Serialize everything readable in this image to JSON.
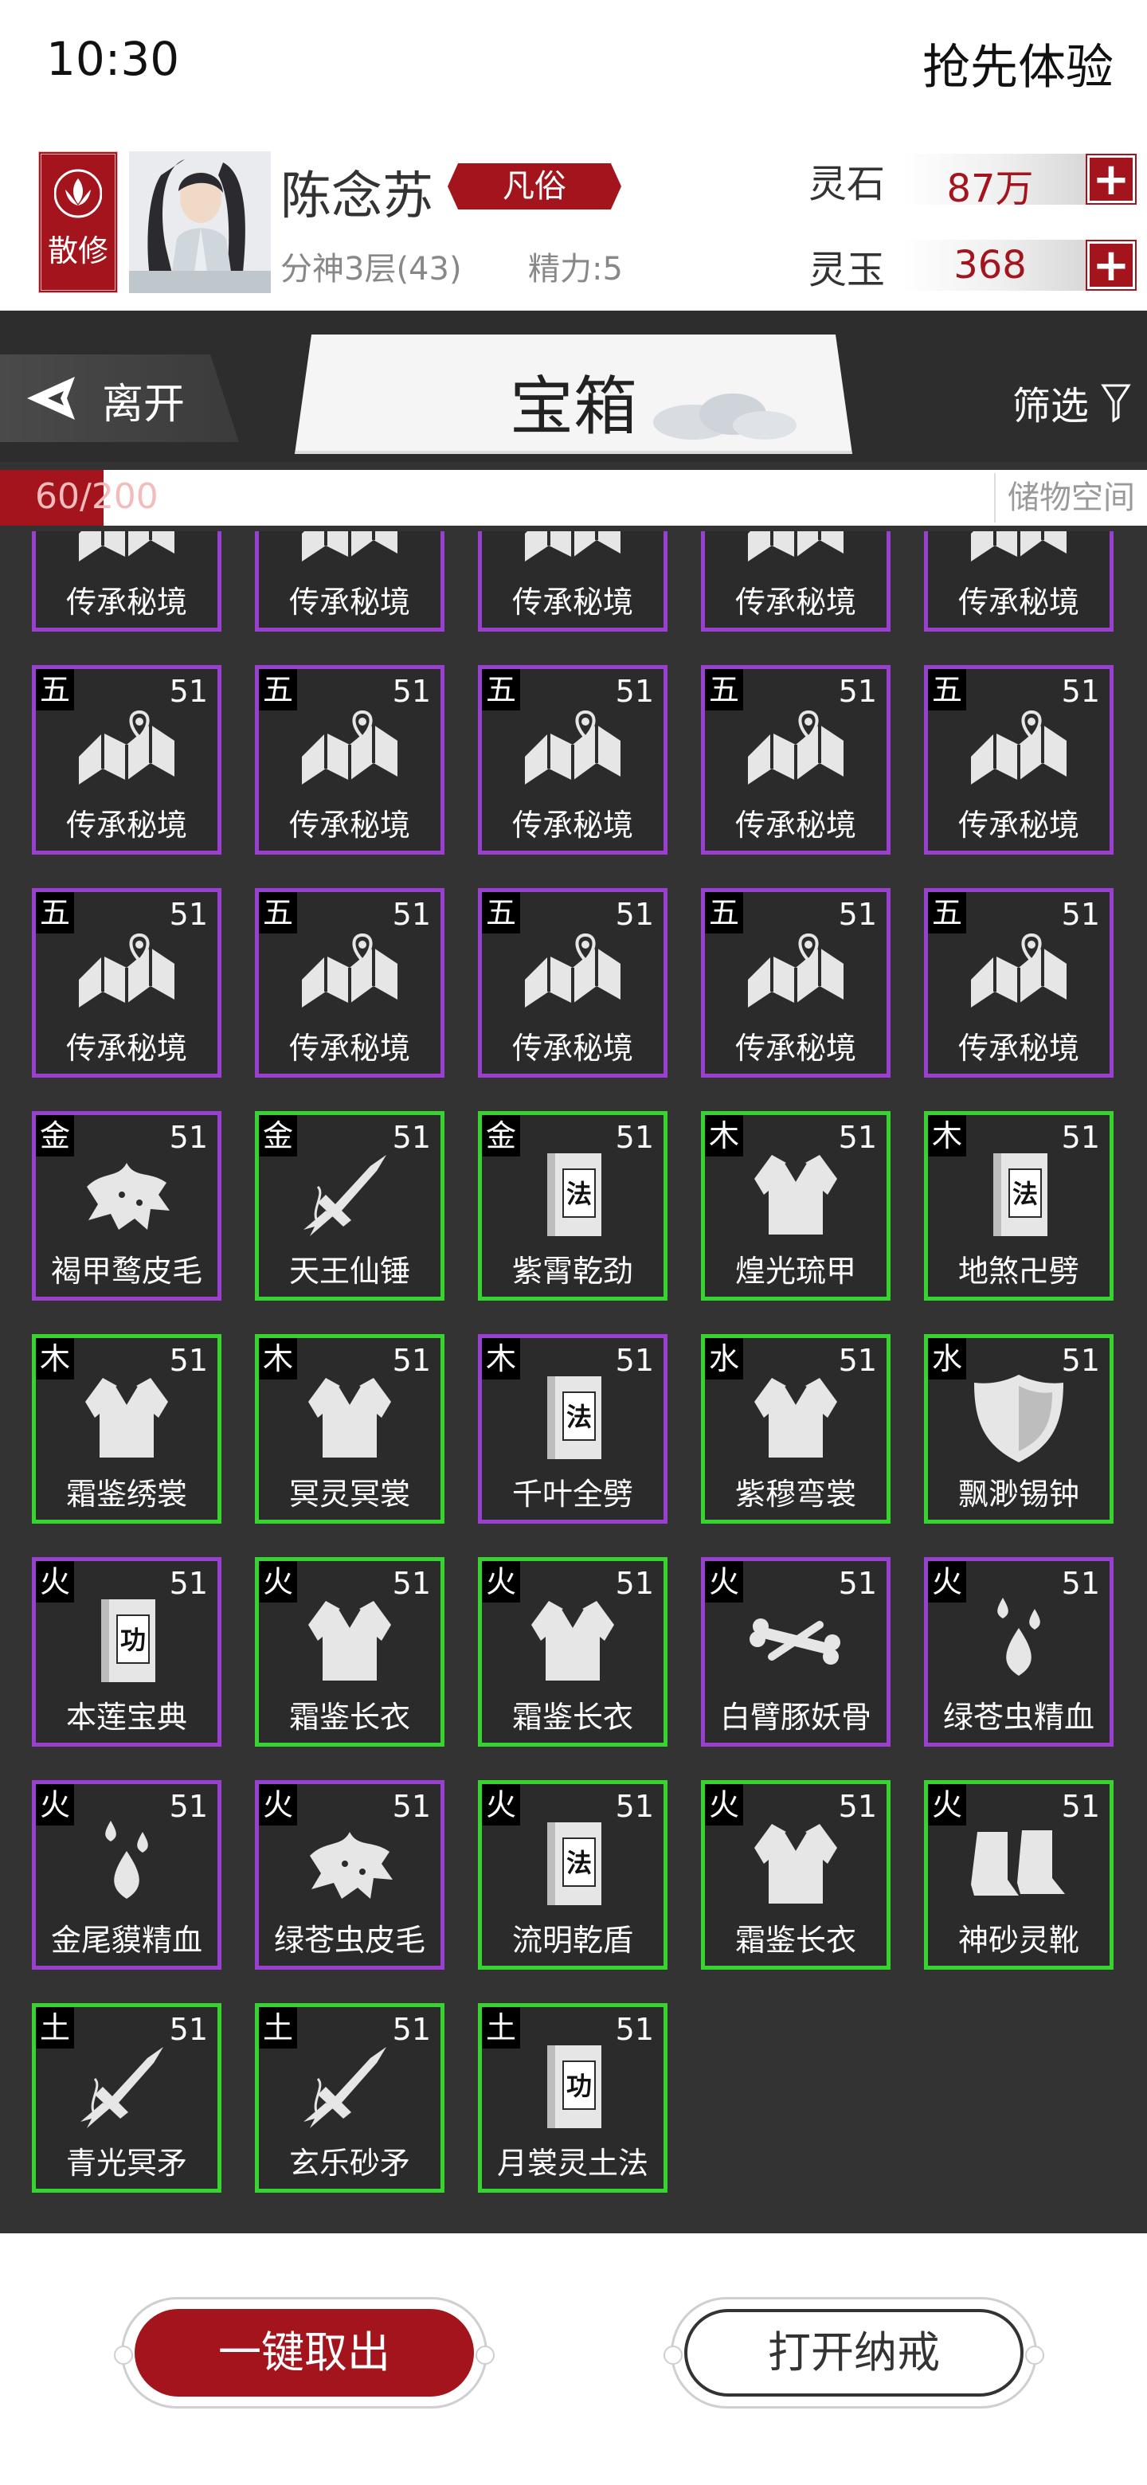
{
  "status_bar": {
    "time": "10:30",
    "trial_label": "抢先体验"
  },
  "profile": {
    "sect": "散修",
    "name": "陈念苏",
    "rank": "凡俗",
    "realm": "分神3层(43)",
    "energy": "精力:5",
    "currencies": [
      {
        "label": "灵石",
        "value": "87万"
      },
      {
        "label": "灵玉",
        "value": "368"
      }
    ]
  },
  "topbar": {
    "leave_label": "离开",
    "title": "宝箱",
    "filter_label": "筛选"
  },
  "capacity": {
    "count": "60/200",
    "used": 60,
    "max": 200,
    "storage_label": "储物空间"
  },
  "colors": {
    "accent": "#a3141c",
    "purple_rarity": "#9b3fd0",
    "green_rarity": "#35d42e"
  },
  "items": [
    {
      "elem": "",
      "level": "",
      "name": "传承秘境",
      "icon": "scroll-map-icon",
      "rarity": "purple"
    },
    {
      "elem": "",
      "level": "",
      "name": "传承秘境",
      "icon": "scroll-map-icon",
      "rarity": "purple"
    },
    {
      "elem": "",
      "level": "",
      "name": "传承秘境",
      "icon": "scroll-map-icon",
      "rarity": "purple"
    },
    {
      "elem": "",
      "level": "",
      "name": "传承秘境",
      "icon": "scroll-map-icon",
      "rarity": "purple"
    },
    {
      "elem": "",
      "level": "",
      "name": "传承秘境",
      "icon": "scroll-map-icon",
      "rarity": "purple"
    },
    {
      "elem": "五",
      "level": "51",
      "name": "传承秘境",
      "icon": "scroll-map-icon",
      "rarity": "purple"
    },
    {
      "elem": "五",
      "level": "51",
      "name": "传承秘境",
      "icon": "scroll-map-icon",
      "rarity": "purple"
    },
    {
      "elem": "五",
      "level": "51",
      "name": "传承秘境",
      "icon": "scroll-map-icon",
      "rarity": "purple"
    },
    {
      "elem": "五",
      "level": "51",
      "name": "传承秘境",
      "icon": "scroll-map-icon",
      "rarity": "purple"
    },
    {
      "elem": "五",
      "level": "51",
      "name": "传承秘境",
      "icon": "scroll-map-icon",
      "rarity": "purple"
    },
    {
      "elem": "五",
      "level": "51",
      "name": "传承秘境",
      "icon": "scroll-map-icon",
      "rarity": "purple"
    },
    {
      "elem": "五",
      "level": "51",
      "name": "传承秘境",
      "icon": "scroll-map-icon",
      "rarity": "purple"
    },
    {
      "elem": "五",
      "level": "51",
      "name": "传承秘境",
      "icon": "scroll-map-icon",
      "rarity": "purple"
    },
    {
      "elem": "五",
      "level": "51",
      "name": "传承秘境",
      "icon": "scroll-map-icon",
      "rarity": "purple"
    },
    {
      "elem": "五",
      "level": "51",
      "name": "传承秘境",
      "icon": "scroll-map-icon",
      "rarity": "purple"
    },
    {
      "elem": "金",
      "level": "51",
      "name": "褐甲鹜皮毛",
      "icon": "pelt-icon",
      "rarity": "purple"
    },
    {
      "elem": "金",
      "level": "51",
      "name": "天王仙锤",
      "icon": "weapon-icon",
      "rarity": "green"
    },
    {
      "elem": "金",
      "level": "51",
      "name": "紫霄乾劲",
      "icon": "manual-fa-icon",
      "rarity": "green"
    },
    {
      "elem": "木",
      "level": "51",
      "name": "煌光琉甲",
      "icon": "robe-icon",
      "rarity": "green"
    },
    {
      "elem": "木",
      "level": "51",
      "name": "地煞卍劈",
      "icon": "manual-fa-icon",
      "rarity": "green"
    },
    {
      "elem": "木",
      "level": "51",
      "name": "霜鉴绣裳",
      "icon": "robe-icon",
      "rarity": "green"
    },
    {
      "elem": "木",
      "level": "51",
      "name": "冥灵冥裳",
      "icon": "robe-icon",
      "rarity": "green"
    },
    {
      "elem": "木",
      "level": "51",
      "name": "千叶全劈",
      "icon": "manual-fa-icon",
      "rarity": "purple"
    },
    {
      "elem": "水",
      "level": "51",
      "name": "紫穆弯裳",
      "icon": "robe-icon",
      "rarity": "green"
    },
    {
      "elem": "水",
      "level": "51",
      "name": "飘渺锡钟",
      "icon": "shield-icon",
      "rarity": "green"
    },
    {
      "elem": "火",
      "level": "51",
      "name": "本莲宝典",
      "icon": "manual-gong-icon",
      "rarity": "purple"
    },
    {
      "elem": "火",
      "level": "51",
      "name": "霜鉴长衣",
      "icon": "robe-icon",
      "rarity": "green"
    },
    {
      "elem": "火",
      "level": "51",
      "name": "霜鉴长衣",
      "icon": "robe-icon",
      "rarity": "green"
    },
    {
      "elem": "火",
      "level": "51",
      "name": "白臂豚妖骨",
      "icon": "bone-icon",
      "rarity": "purple"
    },
    {
      "elem": "火",
      "level": "51",
      "name": "绿苍虫精血",
      "icon": "blood-drops-icon",
      "rarity": "purple"
    },
    {
      "elem": "火",
      "level": "51",
      "name": "金尾貘精血",
      "icon": "blood-drops-icon",
      "rarity": "purple"
    },
    {
      "elem": "火",
      "level": "51",
      "name": "绿苍虫皮毛",
      "icon": "pelt-icon",
      "rarity": "purple"
    },
    {
      "elem": "火",
      "level": "51",
      "name": "流明乾盾",
      "icon": "manual-fa-icon",
      "rarity": "green"
    },
    {
      "elem": "火",
      "level": "51",
      "name": "霜鉴长衣",
      "icon": "robe-icon",
      "rarity": "green"
    },
    {
      "elem": "火",
      "level": "51",
      "name": "神砂灵靴",
      "icon": "boots-icon",
      "rarity": "green"
    },
    {
      "elem": "土",
      "level": "51",
      "name": "青光冥矛",
      "icon": "weapon-icon",
      "rarity": "green"
    },
    {
      "elem": "土",
      "level": "51",
      "name": "玄乐砂矛",
      "icon": "weapon-icon",
      "rarity": "green"
    },
    {
      "elem": "土",
      "level": "51",
      "name": "月裳灵土法",
      "icon": "manual-gong-icon",
      "rarity": "green"
    }
  ],
  "icon_glyphs": {
    "manual_fa": "法",
    "manual_gong": "功"
  },
  "footer": {
    "take_all_label": "一键取出",
    "open_ring_label": "打开纳戒"
  }
}
